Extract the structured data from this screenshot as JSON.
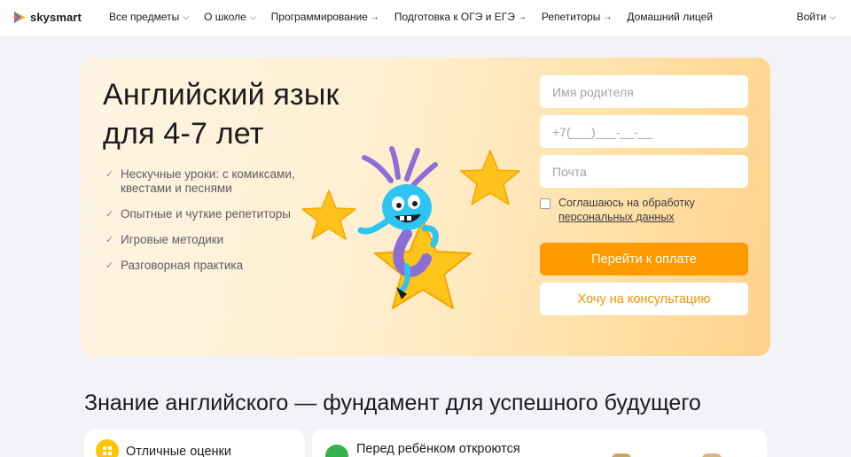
{
  "header": {
    "logo_text": "skysmart",
    "nav": [
      {
        "label": "Все предметы",
        "marker": "chevron-down"
      },
      {
        "label": "О школе",
        "marker": "chevron-down"
      },
      {
        "label": "Программирование",
        "marker": "arrow-right"
      },
      {
        "label": "Подготовка к ОГЭ и ЕГЭ",
        "marker": "arrow-right"
      },
      {
        "label": "Репетиторы",
        "marker": "arrow-right"
      },
      {
        "label": "Домашний лицей",
        "marker": "none"
      }
    ],
    "login_label": "Войти"
  },
  "hero": {
    "title_line1": "Английский язык",
    "title_line2": "для 4-7 лет",
    "features": [
      "Нескучные уроки: с комиксами, квестами и песнями",
      "Опытные и чуткие репетиторы",
      "Игровые методики",
      "Разговорная практика"
    ]
  },
  "form": {
    "parent_name_placeholder": "Имя родителя",
    "phone_placeholder": "+7(___)___-__-__",
    "email_placeholder": "Почта",
    "consent_text": "Соглашаюсь на обработку",
    "consent_link": "персональных данных",
    "pay_button": "Перейти к оплате",
    "consult_button": "Хочу на консультацию"
  },
  "section": {
    "title": "Знание английского — фундамент для успешного будущего",
    "cards": [
      {
        "text": "Отличные оценки"
      },
      {
        "text": "Перед ребёнком откроются"
      }
    ]
  },
  "colors": {
    "accent_orange": "#fd9a00",
    "link_orange": "#f29100",
    "star_yellow": "#ffc400",
    "mascot_blue": "#2ec4f2",
    "antenna_purple": "#8b6fd6",
    "green": "#34b34a"
  }
}
